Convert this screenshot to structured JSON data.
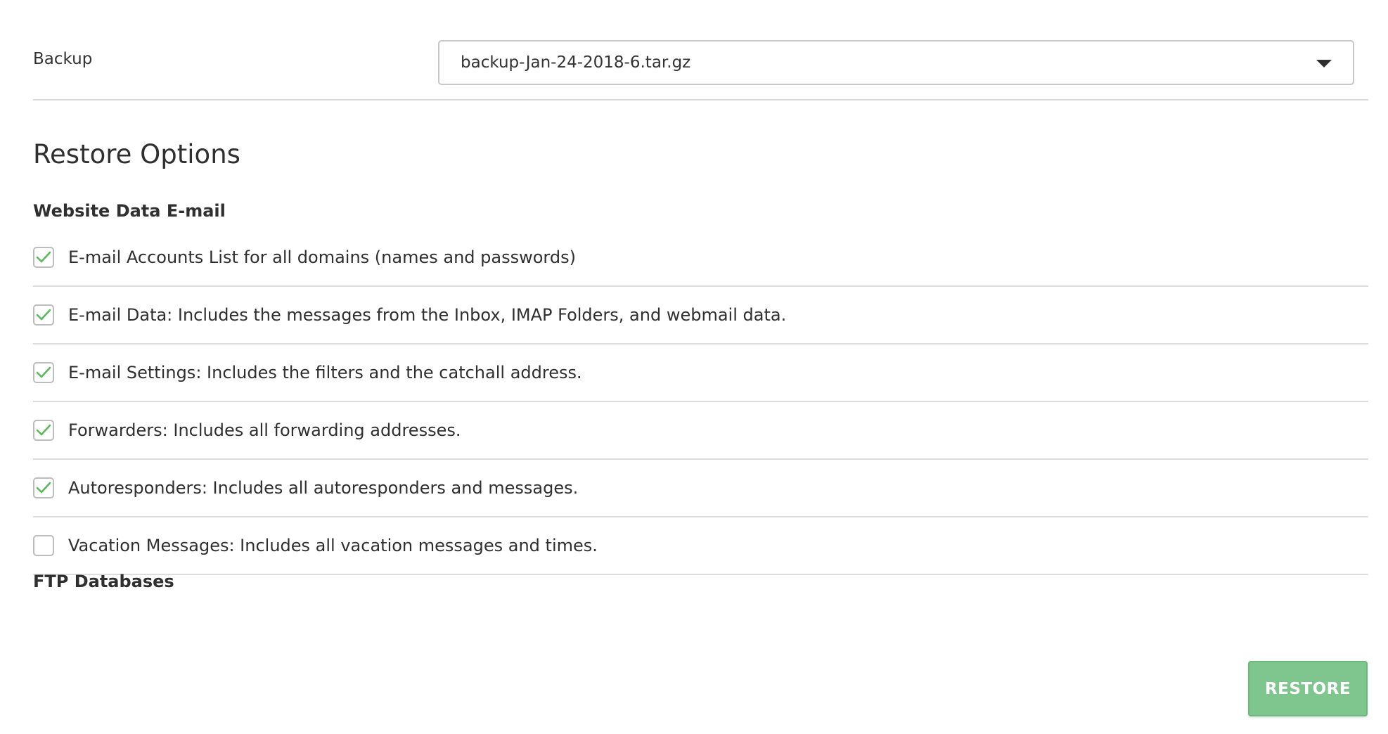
{
  "backup": {
    "label": "Backup",
    "selected": "backup-Jan-24-2018-6.tar.gz"
  },
  "restore_options": {
    "title": "Restore Options",
    "group_title": "Website Data E-mail",
    "items": [
      {
        "label": "E-mail Accounts List for all domains (names and passwords)",
        "checked": true
      },
      {
        "label": "E-mail Data: Includes the messages from the Inbox, IMAP Folders, and webmail data.",
        "checked": true
      },
      {
        "label": "E-mail Settings: Includes the filters and the catchall address.",
        "checked": true
      },
      {
        "label": "Forwarders: Includes all forwarding addresses.",
        "checked": true
      },
      {
        "label": "Autoresponders: Includes all autoresponders and messages.",
        "checked": true
      },
      {
        "label": "Vacation Messages: Includes all vacation messages and times.",
        "checked": false
      }
    ],
    "secondary_group_title": "FTP Databases"
  },
  "actions": {
    "restore_label": "RESTORE"
  },
  "colors": {
    "check": "#5cb85c",
    "button_bg": "#7fc68e"
  },
  "icons": {
    "dropdown": "caret-down-icon",
    "checked": "checkmark-icon"
  }
}
